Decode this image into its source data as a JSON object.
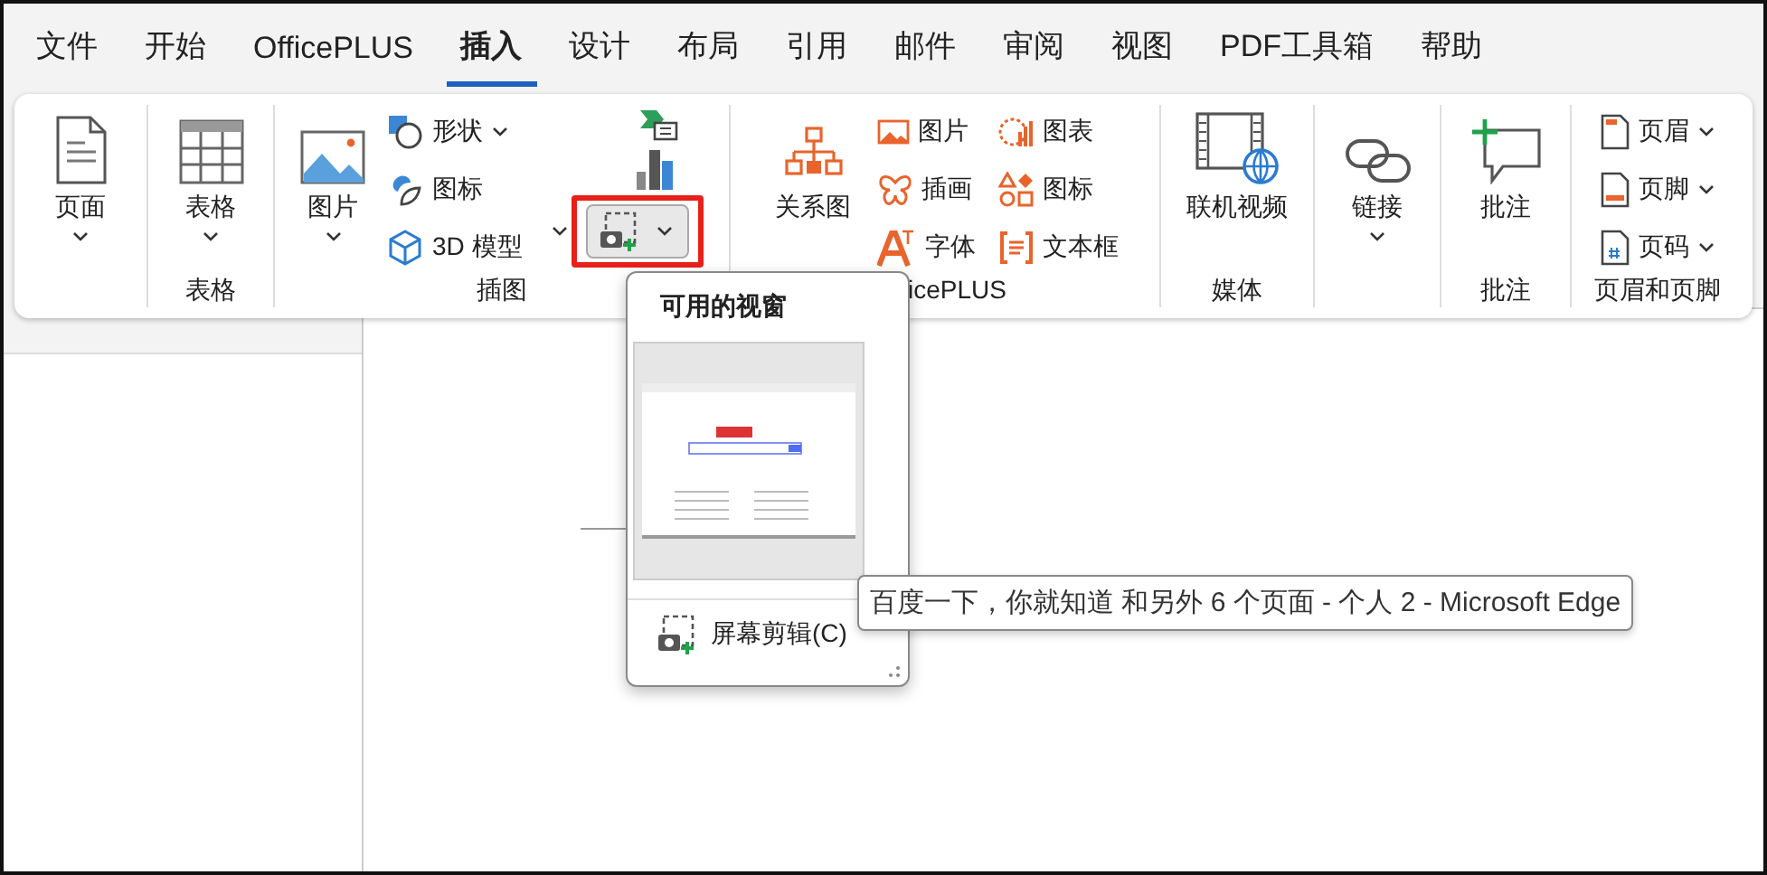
{
  "tabs": [
    {
      "label": "文件",
      "selected": false
    },
    {
      "label": "开始",
      "selected": false
    },
    {
      "label": "OfficePLUS",
      "selected": false
    },
    {
      "label": "插入",
      "selected": true
    },
    {
      "label": "设计",
      "selected": false
    },
    {
      "label": "布局",
      "selected": false
    },
    {
      "label": "引用",
      "selected": false
    },
    {
      "label": "邮件",
      "selected": false
    },
    {
      "label": "审阅",
      "selected": false
    },
    {
      "label": "视图",
      "selected": false
    },
    {
      "label": "PDF工具箱",
      "selected": false
    },
    {
      "label": "帮助",
      "selected": false
    }
  ],
  "ribbon": {
    "page": {
      "button": "页面"
    },
    "table": {
      "button": "表格",
      "group_label": "表格"
    },
    "illustrations": {
      "picture": "图片",
      "shapes": "形状",
      "icons": "图标",
      "model_3d": "3D 模型",
      "group_label": "插图"
    },
    "officeplus": {
      "diagram": "关系图",
      "picture": "图片",
      "illustration": "插画",
      "font": "字体",
      "chart": "图表",
      "icons": "图标",
      "text_box": "文本框",
      "group_label": "icePLUS"
    },
    "media": {
      "online_video": "联机视频",
      "group_label": "媒体"
    },
    "links": {
      "link": "链接"
    },
    "comments": {
      "comment": "批注",
      "group_label": "批注"
    },
    "header_footer": {
      "header": "页眉",
      "footer": "页脚",
      "page_number": "页码",
      "group_label": "页眉和页脚"
    }
  },
  "screenshot_menu": {
    "expanded": true,
    "title": "可用的视窗",
    "screen_clipping": "屏幕剪辑(C)"
  },
  "tooltip": "百度一下，你就知道 和另外 6 个页面 - 个人 2 - Microsoft Edge"
}
